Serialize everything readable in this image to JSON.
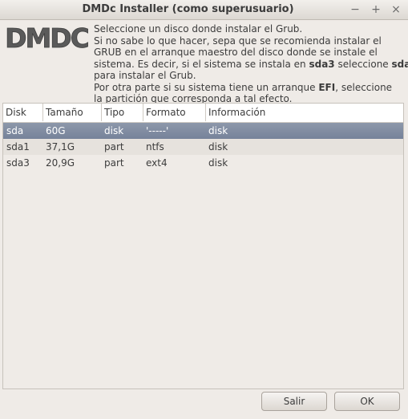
{
  "window": {
    "title": "DMDc Installer (como superusuario)",
    "controls": {
      "minimize": "−",
      "maximize": "+",
      "close": "×"
    }
  },
  "logo": {
    "text": "DMDC"
  },
  "info": {
    "line1": "Seleccione un disco donde instalar el Grub.",
    "line2": "Si no sabe lo que hacer, sepa que se recomienda instalar el",
    "line3": "GRUB en el arranque maestro del disco donde se instale el",
    "line4_pre": "sistema. Es decir, si el sistema se instala en ",
    "line4_b1": "sda3",
    "line4_mid": " seleccione ",
    "line4_b2": "sda",
    "line5": "para instalar el Grub.",
    "line6_pre": "Por otra parte si su sistema tiene un arranque ",
    "line6_b": "EFI",
    "line6_post": ", seleccione",
    "line7": "la partición que corresponda a tal efecto."
  },
  "table": {
    "headers": [
      "Disk",
      "Tamaño",
      "Tipo",
      "Formato",
      "Información"
    ],
    "rows": [
      [
        "sda",
        "60G",
        "disk",
        "'-----'",
        "disk"
      ],
      [
        "sda1",
        "37,1G",
        "part",
        "ntfs",
        "disk"
      ],
      [
        "sda3",
        "20,9G",
        "part",
        "ext4",
        "disk"
      ]
    ],
    "selected_row": 0
  },
  "buttons": {
    "exit": "Salir",
    "ok": "OK"
  },
  "colors": {
    "selection": "#7d889e",
    "window_bg": "#efebe7"
  }
}
